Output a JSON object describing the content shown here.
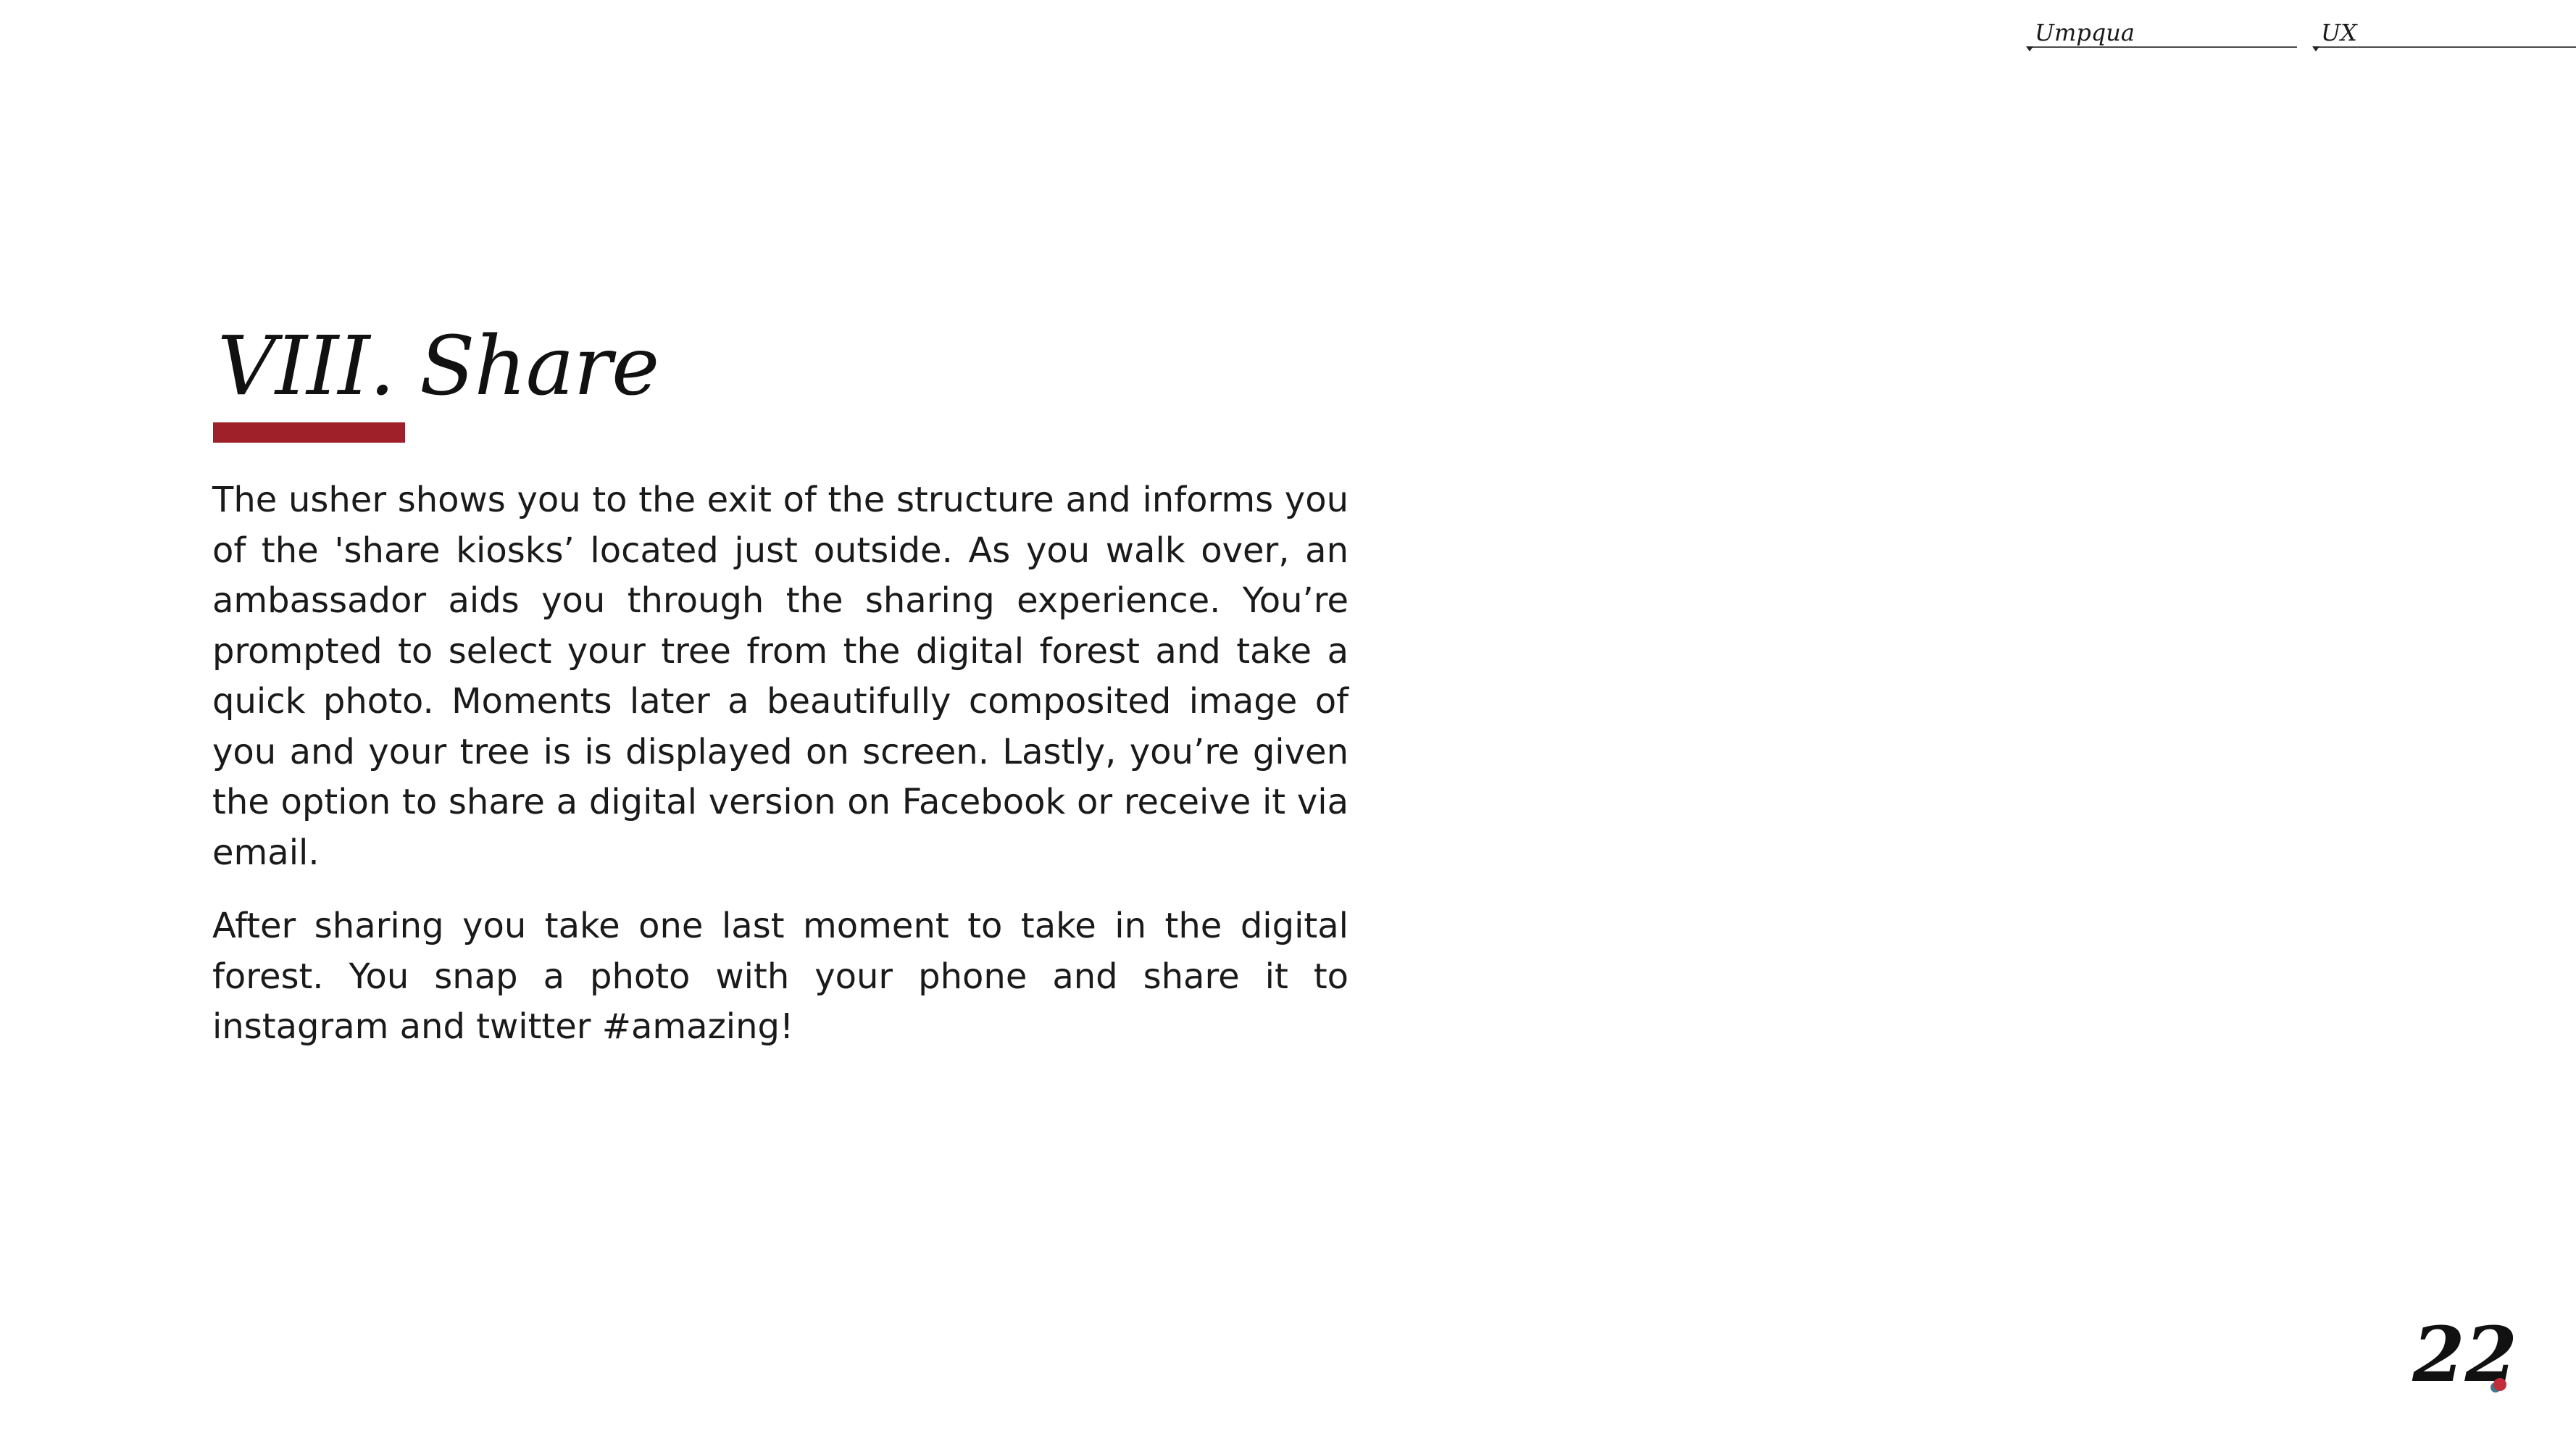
{
  "header": {
    "nav": [
      {
        "label": "Umpqua"
      },
      {
        "label": "UX"
      }
    ]
  },
  "section": {
    "title": "VIII. Share",
    "accent_color": "#a0202a",
    "paragraphs": [
      "The usher shows you to the exit of the structure and informs you of the 'share kiosks’ located just outside. As you walk over, an ambassador aids you through the sharing experience. You’re prompted to select your tree from the digital forest and take a quick photo. Moments later a beautifully composited image of you and your tree is is displayed on screen. Lastly, you’re given the option to share a digital version on Facebook or receive it via email.",
      "After sharing you take one last moment to take in the digital forest. You snap a photo with your phone and share it to instagram and twitter #amazing!"
    ]
  },
  "footer": {
    "page_number": "22"
  }
}
